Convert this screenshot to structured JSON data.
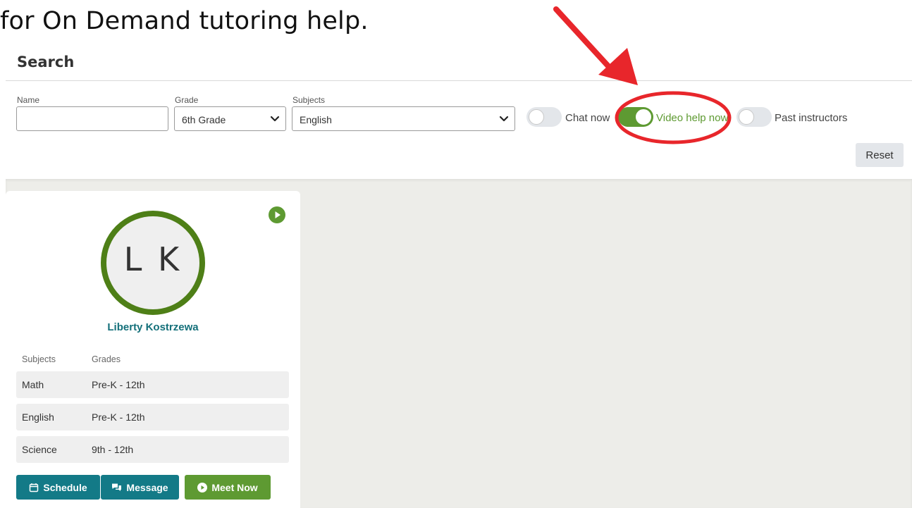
{
  "headline": "for On Demand tutoring help.",
  "search": {
    "title": "Search",
    "name_label": "Name",
    "name_value": "",
    "grade_label": "Grade",
    "grade_value": "6th Grade",
    "subjects_label": "Subjects",
    "subjects_value": "English",
    "toggles": [
      {
        "label": "Chat now",
        "on": false
      },
      {
        "label": "Video help now",
        "on": true
      },
      {
        "label": "Past instructors",
        "on": false
      }
    ],
    "reset_label": "Reset"
  },
  "tutor": {
    "initials": "L K",
    "name": "Liberty Kostrzewa",
    "columns": [
      "Subjects",
      "Grades"
    ],
    "rows": [
      {
        "subject": "Math",
        "grades": "Pre-K - 12th"
      },
      {
        "subject": "English",
        "grades": "Pre-K - 12th"
      },
      {
        "subject": "Science",
        "grades": "9th - 12th"
      }
    ],
    "actions": {
      "schedule": "Schedule",
      "message": "Message",
      "meet_now": "Meet Now"
    }
  },
  "icons": {
    "play_badge": "play-circle-icon",
    "schedule": "calendar-icon",
    "message": "chat-bubbles-icon",
    "meet_now": "play-circle-icon",
    "select_chevron": "chevron-down-icon"
  },
  "colors": {
    "accent_green": "#5e9a32",
    "avatar_ring": "#4e7f17",
    "teal": "#137a87",
    "tutor_name": "#14707a",
    "annotation_red": "#e8262b"
  }
}
